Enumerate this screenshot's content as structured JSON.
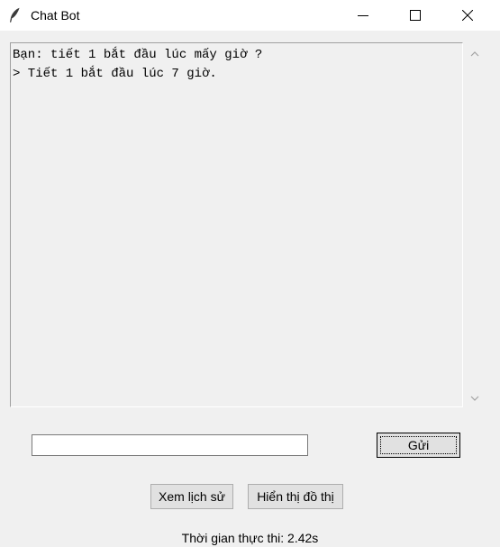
{
  "window": {
    "title": "Chat Bot",
    "icon": "feather-icon"
  },
  "chat": {
    "lines": [
      "Bạn: tiết 1 bắt đầu lúc mấy giờ ?",
      "> Tiết 1 bắt đầu lúc 7 giờ."
    ]
  },
  "input": {
    "value": ""
  },
  "buttons": {
    "send_label": "Gửi",
    "history_label": "Xem lịch sử",
    "chart_label": "Hiển thị đồ thị"
  },
  "status": {
    "execution_time": "Thời gian thực thi: 2.42s"
  }
}
